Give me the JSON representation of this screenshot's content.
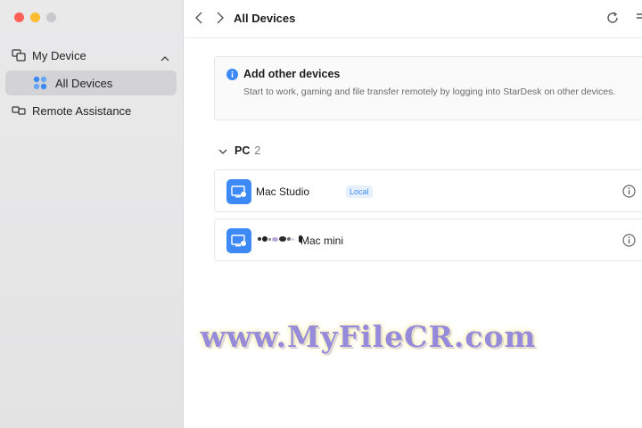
{
  "window": {
    "title": "All Devices"
  },
  "sidebar": {
    "group_label": "My Device",
    "items": [
      {
        "label": "All Devices",
        "icon": "grid-dots-icon",
        "selected": true
      }
    ],
    "remote_label": "Remote Assistance"
  },
  "main": {
    "title": "All Devices",
    "add_card": {
      "title": "Add other devices",
      "description": "Start to work, gaming and file transfer remotely by logging into StarDesk on other devices."
    },
    "section": {
      "label": "PC",
      "count": "2"
    },
    "devices": [
      {
        "name": "Mac Studio",
        "badge": "Local"
      },
      {
        "name": "Mac mini"
      }
    ]
  },
  "watermark": "www.MyFileCR.com",
  "colors": {
    "accent": "#3d8af7",
    "sidebar_bg": "#e8e8e9",
    "selected_bg": "#d3d3d5"
  }
}
